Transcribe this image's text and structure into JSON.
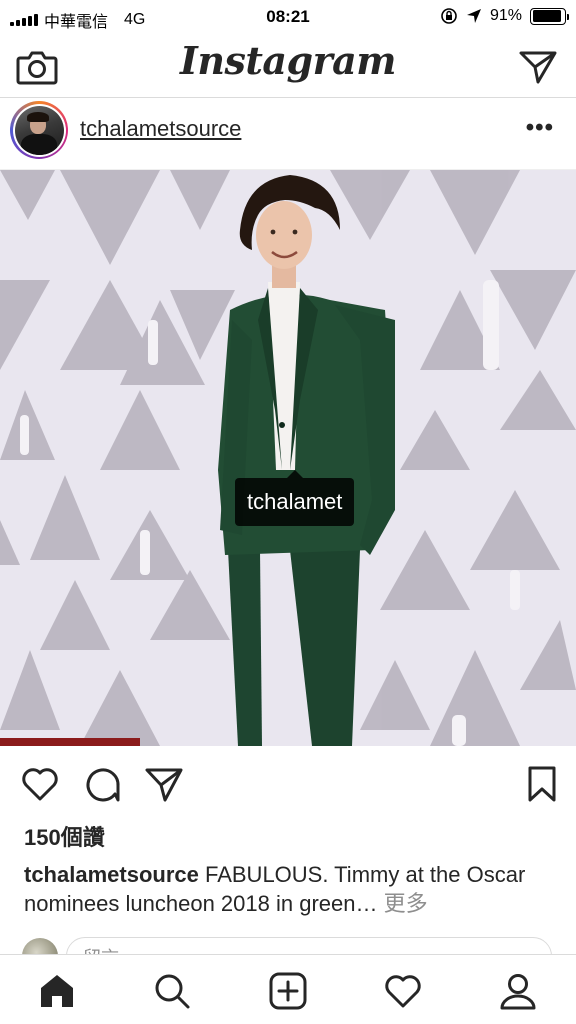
{
  "status_bar": {
    "carrier": "中華電信",
    "network": "4G",
    "time": "08:21",
    "battery_text": "91%",
    "battery_level": 0.91
  },
  "header": {
    "title": "Instagram",
    "camera_icon": "camera-icon",
    "direct_icon": "paper-plane-icon"
  },
  "post": {
    "username": "tchalametsource",
    "more_label": "•••",
    "photo_tag": "tchalamet",
    "likes": "150個讚",
    "caption_user": "tchalametsource",
    "caption_text": "FABULOUS. Timmy at the Oscar nominees luncheon 2018 in green…",
    "caption_more": "更多",
    "comment_placeholder": "留言…"
  },
  "actions": [
    "heart-icon",
    "comment-icon",
    "share-icon",
    "bookmark-icon"
  ],
  "tabbar": [
    "home-icon",
    "search-icon",
    "add-post-icon",
    "activity-heart-icon",
    "profile-icon"
  ],
  "colors": {
    "text": "#262626",
    "muted": "#8e8e8e",
    "border": "#dbdbdb",
    "suit": "#1e4a30",
    "backdrop": "#e8e4ef"
  }
}
